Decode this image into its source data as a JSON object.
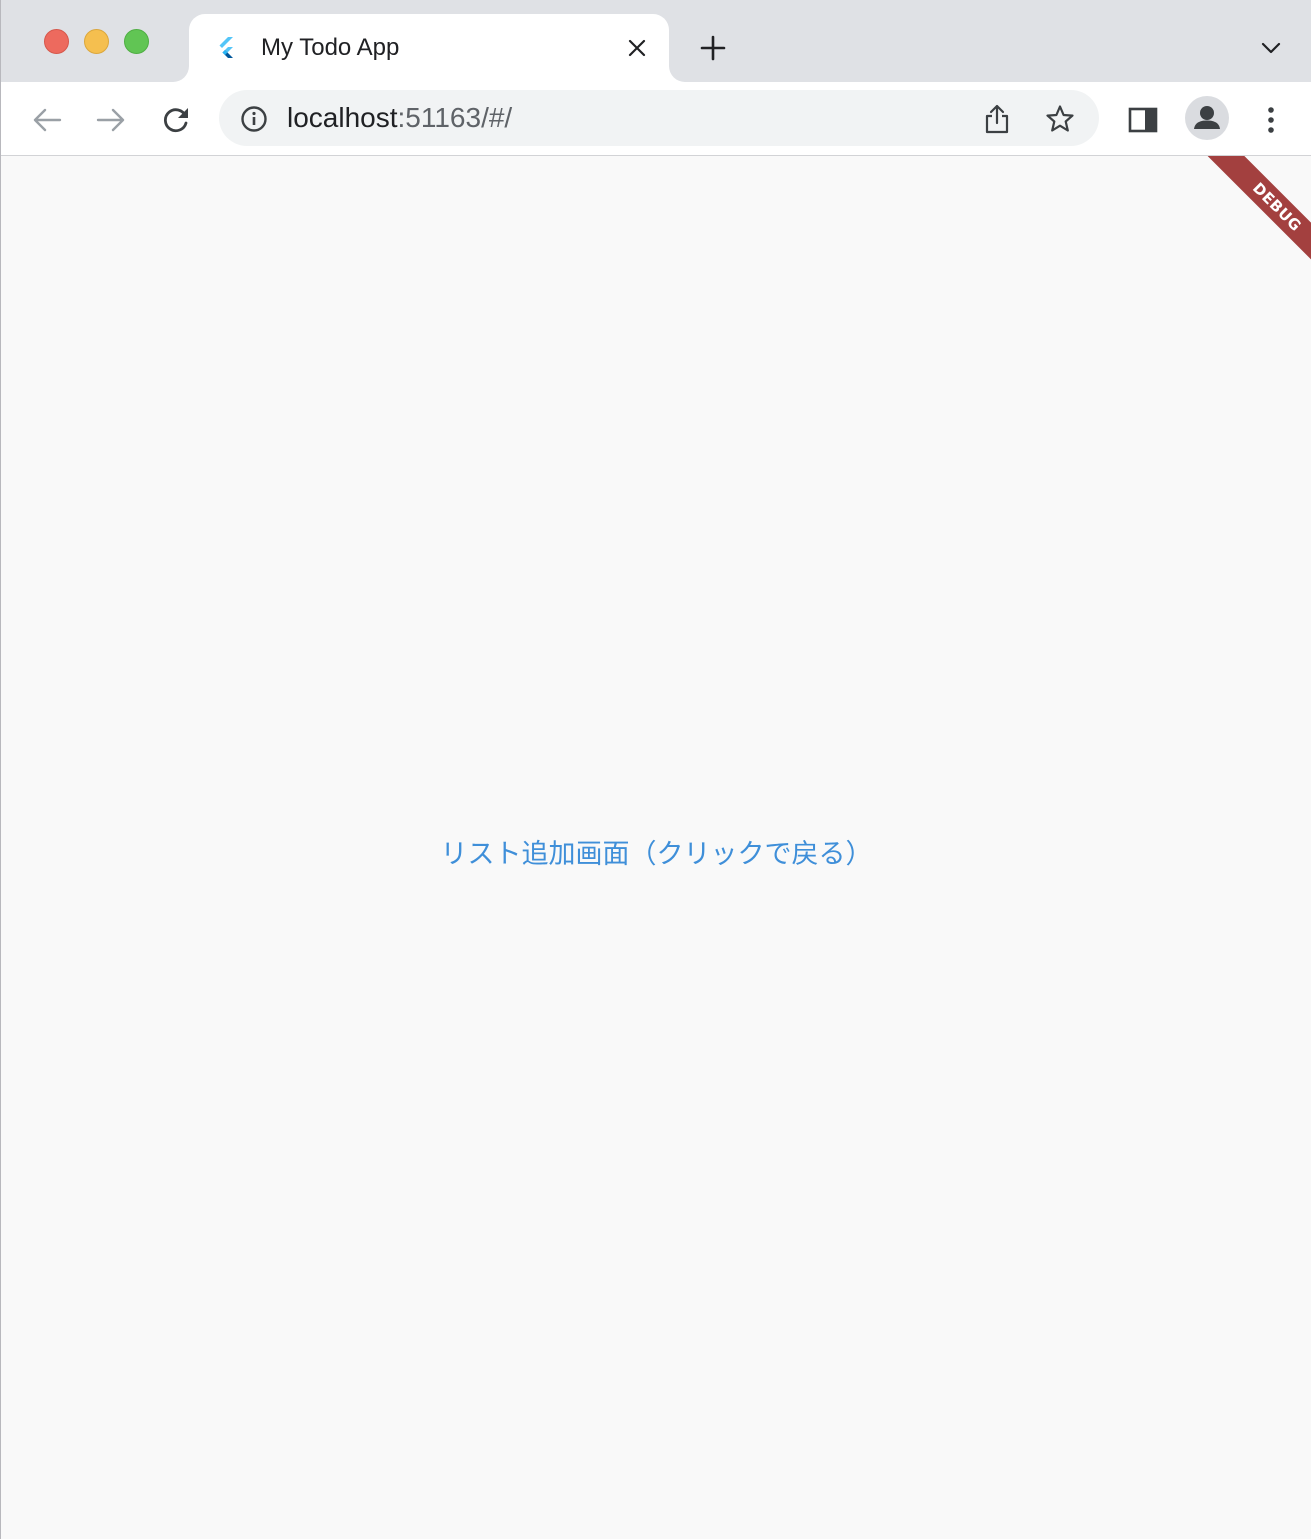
{
  "browser": {
    "tab": {
      "title": "My Todo App",
      "favicon": "flutter-icon"
    },
    "address": {
      "host": "localhost",
      "rest": ":51163/#/"
    },
    "icons": {
      "back": "arrow-left-icon",
      "forward": "arrow-right-icon",
      "reload": "reload-icon",
      "info": "info-icon",
      "share": "share-icon",
      "bookmark": "star-icon",
      "side_panel": "side-panel-icon",
      "profile": "person-icon",
      "menu": "kebab-menu-icon",
      "new_tab": "plus-icon",
      "tab_search": "chevron-down-icon",
      "close_tab": "close-icon"
    }
  },
  "page": {
    "debug_banner": "DEBUG",
    "link_text": "リスト追加画面（クリックで戻る）"
  },
  "colors": {
    "tabstrip": "#dfe1e5",
    "page_background": "#f9f9f9",
    "link": "#3f8fd9",
    "debug_ribbon": "#a3403f"
  }
}
